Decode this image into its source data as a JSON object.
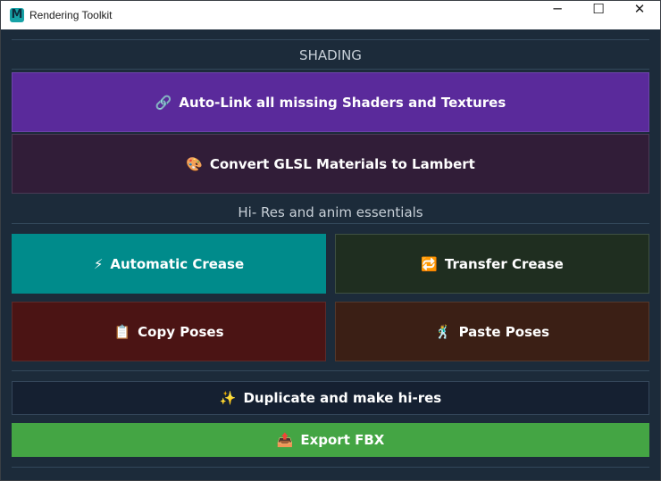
{
  "window": {
    "title": "Rendering Toolkit",
    "app_icon": "M",
    "controls": {
      "minimize": "─",
      "maximize": "☐",
      "close": "✕"
    }
  },
  "sections": {
    "shading": "SHADING",
    "hires": "Hi- Res and anim essentials"
  },
  "buttons": {
    "autolink": {
      "icon": "🔗",
      "label": "Auto-Link all missing Shaders and Textures"
    },
    "convert": {
      "icon": "🎨",
      "label": "Convert GLSL Materials to Lambert"
    },
    "auto_crease": {
      "icon": "⚡",
      "label": "Automatic Crease"
    },
    "transfer_crease": {
      "icon": "🔁",
      "label": "Transfer Crease"
    },
    "copy_poses": {
      "icon": "📋",
      "label": "Copy Poses"
    },
    "paste_poses": {
      "icon": "🕺",
      "label": "Paste Poses"
    },
    "duplicate": {
      "icon": "✨",
      "label": "Duplicate and make hi-res"
    },
    "export": {
      "icon": "📤",
      "label": "Export FBX"
    }
  },
  "colors": {
    "background": "#1c2b3a",
    "autolink": "#5a2a9b",
    "convert": "#311d38",
    "auto_crease": "#008b8b",
    "transfer_crease": "#1f2e20",
    "copy_poses": "#4b1414",
    "paste_poses": "#3b1f15",
    "duplicate": "#152031",
    "export": "#44a544"
  }
}
